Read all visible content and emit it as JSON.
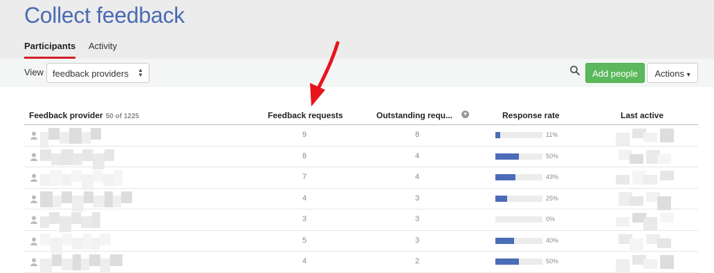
{
  "page": {
    "title": "Collect feedback"
  },
  "tabs": [
    {
      "label": "Participants",
      "active": true
    },
    {
      "label": "Activity",
      "active": false
    }
  ],
  "toolbar": {
    "view_label": "View",
    "view_selected": "feedback providers",
    "add_people_label": "Add people",
    "actions_label": "Actions",
    "actions_caret": "▾"
  },
  "table": {
    "columns": {
      "provider": "Feedback provider",
      "provider_count": "50 of 1225",
      "requests": "Feedback requests",
      "outstanding": "Outstanding requ...",
      "response_rate": "Response rate",
      "last_active": "Last active"
    },
    "rows": [
      {
        "requests": "9",
        "outstanding": "8",
        "rate": 0.11,
        "rate_label": "11%"
      },
      {
        "requests": "8",
        "outstanding": "4",
        "rate": 0.5,
        "rate_label": "50%"
      },
      {
        "requests": "7",
        "outstanding": "4",
        "rate": 0.43,
        "rate_label": "43%"
      },
      {
        "requests": "4",
        "outstanding": "3",
        "rate": 0.25,
        "rate_label": "25%"
      },
      {
        "requests": "3",
        "outstanding": "3",
        "rate": 0.0,
        "rate_label": "0%"
      },
      {
        "requests": "5",
        "outstanding": "3",
        "rate": 0.4,
        "rate_label": "40%"
      },
      {
        "requests": "4",
        "outstanding": "2",
        "rate": 0.5,
        "rate_label": "50%"
      }
    ]
  },
  "colors": {
    "accent": "#4a6bb4",
    "tab_underline": "#d0202a",
    "add_button": "#5cb85c",
    "bar_fill": "#4b6cb7",
    "annotation_arrow": "#e8141c"
  },
  "icons": {
    "search": "search-icon",
    "avatar": "person-icon",
    "sort": "chevron-down-circle-icon",
    "select": "updown-arrows-icon"
  }
}
